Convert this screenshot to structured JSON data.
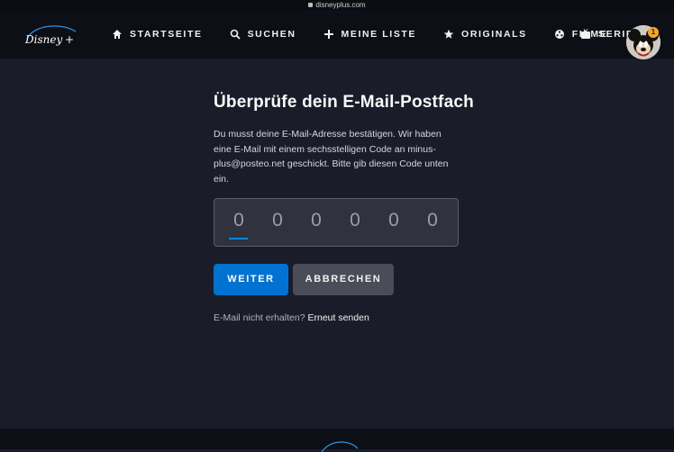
{
  "browser": {
    "url": "disneyplus.com"
  },
  "brand": {
    "logo_alt": "Disney+",
    "accent": "#0072d2",
    "background": "#1a1d29",
    "nav_background": "#0d0f16"
  },
  "nav": {
    "items": [
      {
        "label": "STARTSEITE",
        "icon": "home-icon"
      },
      {
        "label": "SUCHEN",
        "icon": "search-icon"
      },
      {
        "label": "MEINE LISTE",
        "icon": "plus-icon"
      },
      {
        "label": "ORIGINALS",
        "icon": "star-icon"
      },
      {
        "label": "FILME",
        "icon": "film-reel-icon"
      },
      {
        "label": "SERIEN",
        "icon": "tv-icon"
      }
    ],
    "profile_badge": "1"
  },
  "verify": {
    "title": "Überprüfe dein E-Mail-Postfach",
    "description": "Du musst deine E-Mail-Adresse bestätigen. Wir haben eine E-Mail mit einem sechsstelligen Code an minus-plus@posteo.net geschickt. Bitte gib diesen Code unten ein.",
    "code_digits": [
      "0",
      "0",
      "0",
      "0",
      "0",
      "0"
    ],
    "continue_label": "WEITER",
    "cancel_label": "ABBRECHEN",
    "resend_prompt": "E-Mail nicht erhalten?",
    "resend_link": "Erneut senden"
  }
}
